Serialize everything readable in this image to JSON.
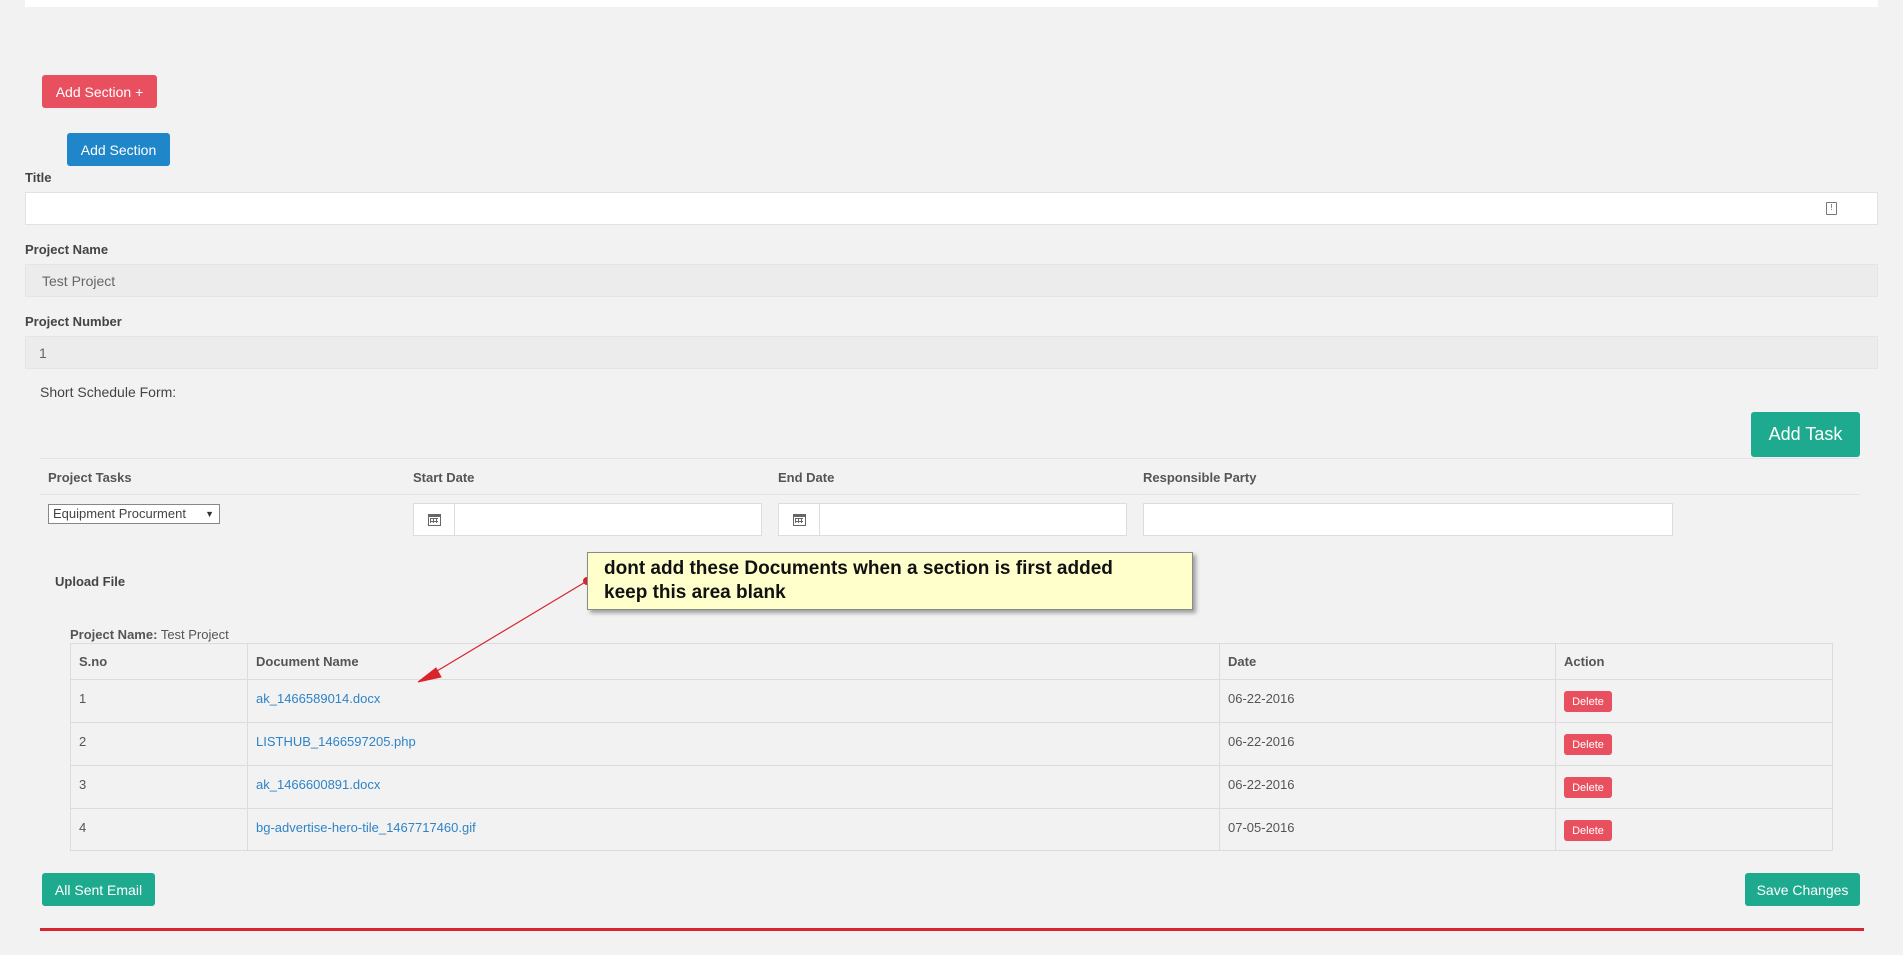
{
  "buttons": {
    "add_section_plus": "Add Section +",
    "add_section": "Add Section",
    "add_task": "Add Task",
    "all_sent_email": "All Sent Email",
    "save_changes": "Save Changes"
  },
  "form": {
    "title_label": "Title",
    "title_value": "",
    "project_name_label": "Project Name",
    "project_name_value": "Test Project",
    "project_number_label": "Project Number",
    "project_number_value": "1",
    "short_schedule_label": "Short Schedule Form:"
  },
  "tasks_table": {
    "headers": [
      "Project Tasks",
      "Start Date",
      "End Date",
      "Responsible Party"
    ],
    "task_select_value": "Equipment Procurment",
    "start_date": "",
    "end_date": "",
    "responsible_party": ""
  },
  "upload": {
    "label": "Upload File",
    "project_name_label": "Project Name:",
    "project_name_value": "Test Project"
  },
  "documents_table": {
    "headers": [
      "S.no",
      "Document Name",
      "Date",
      "Action"
    ],
    "rows": [
      {
        "sno": "1",
        "name": "ak_1466589014.docx",
        "date": "06-22-2016",
        "action": "Delete"
      },
      {
        "sno": "2",
        "name": "LISTHUB_1466597205.php",
        "date": "06-22-2016",
        "action": "Delete"
      },
      {
        "sno": "3",
        "name": "ak_1466600891.docx",
        "date": "06-22-2016",
        "action": "Delete"
      },
      {
        "sno": "4",
        "name": "bg-advertise-hero-tile_1467717460.gif",
        "date": "07-05-2016",
        "action": "Delete"
      }
    ]
  },
  "annotation": {
    "line1": "dont add these Documents when a section is first added",
    "line2": "keep this area blank"
  },
  "colors": {
    "danger": "#e9505f",
    "primary": "#1f86c9",
    "success": "#1eaa8e",
    "link": "#2f83c7",
    "annotation_bg": "#ffffcc",
    "rule": "#d9232d"
  },
  "icons": [
    "calendar-icon",
    "field-info-icon",
    "dropdown-arrow-icon"
  ]
}
